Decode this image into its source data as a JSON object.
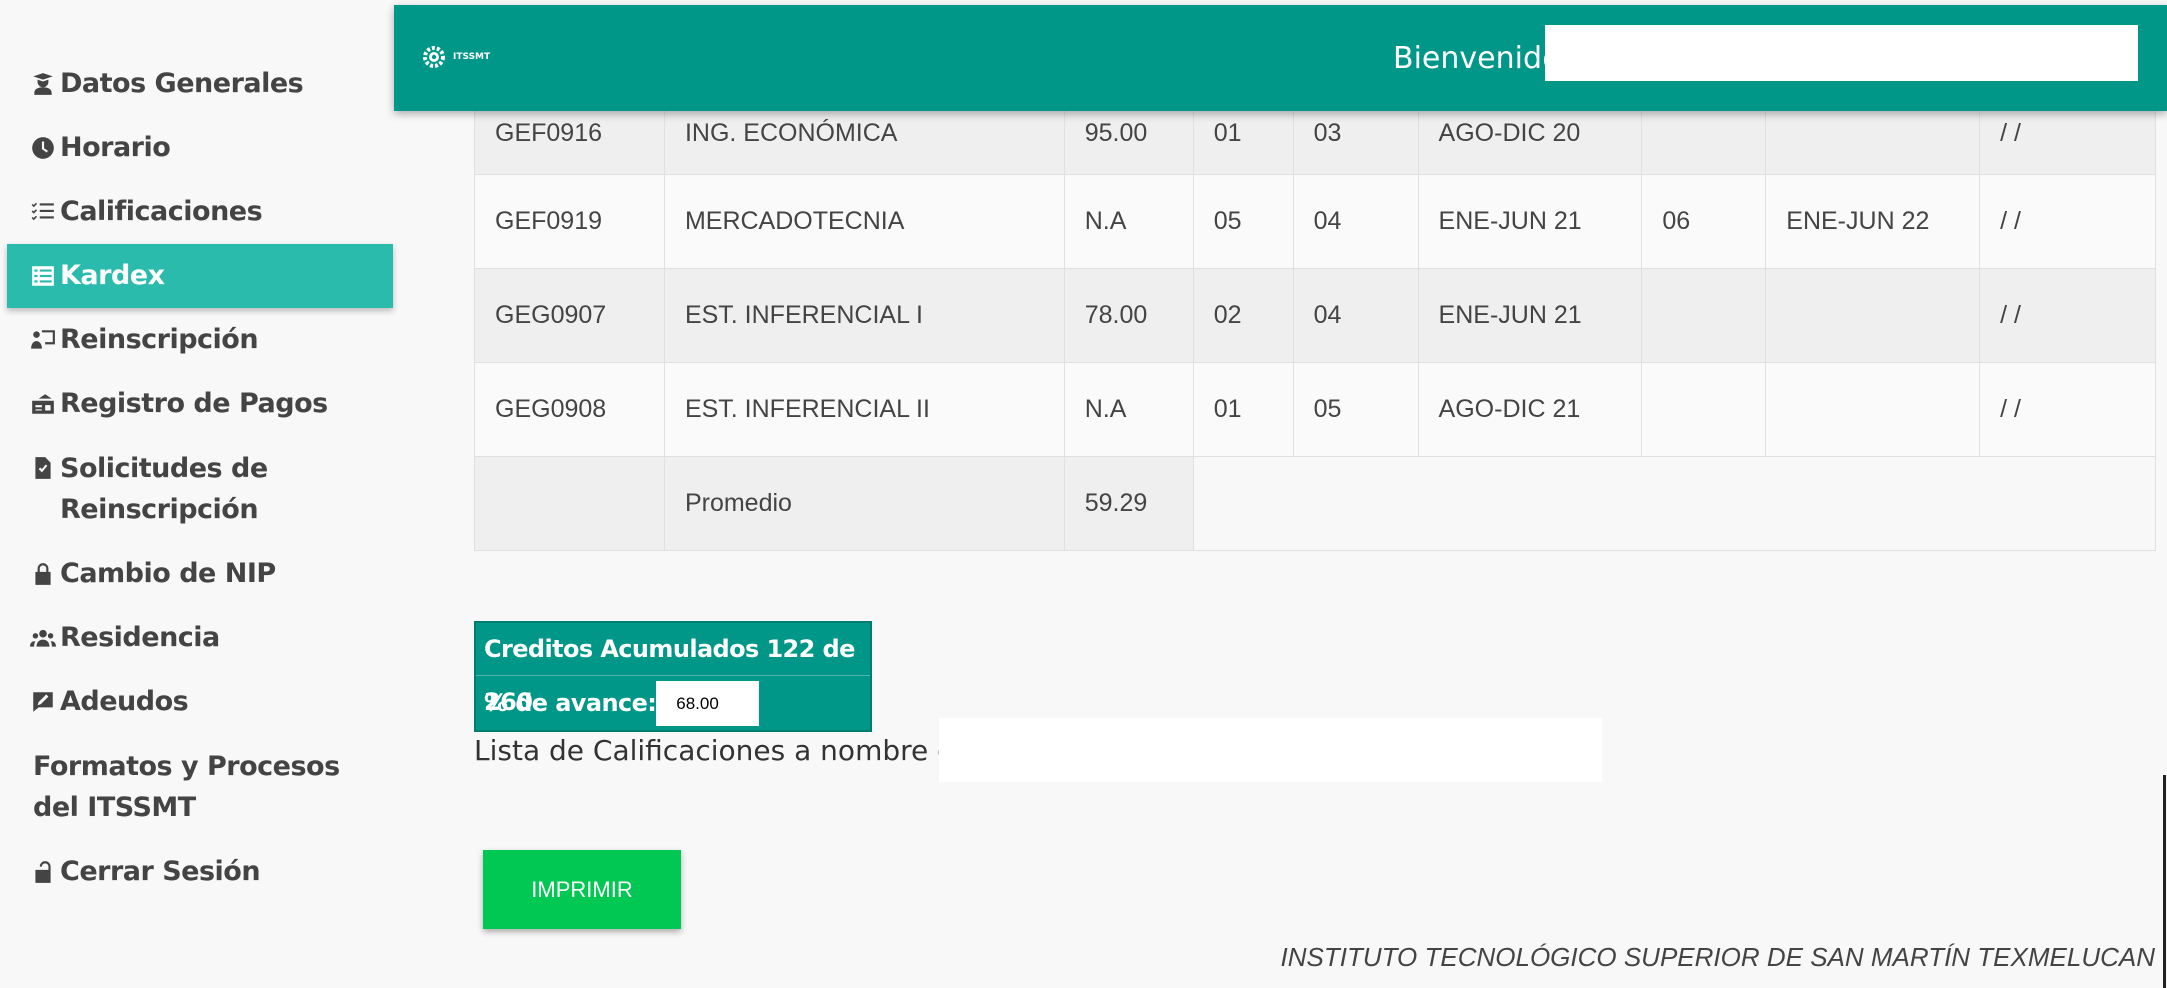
{
  "sidebar": {
    "items": [
      {
        "label": "Datos Generales",
        "icon": "user-graduate-icon"
      },
      {
        "label": "Horario",
        "icon": "clock-icon"
      },
      {
        "label": "Calificaciones",
        "icon": "list-check-icon"
      },
      {
        "label": "Kardex",
        "icon": "list-alt-icon",
        "active": true
      },
      {
        "label": "Reinscripción",
        "icon": "chalkboard-teacher-icon"
      },
      {
        "label": "Registro de Pagos",
        "icon": "money-check-icon"
      },
      {
        "label": "Solicitudes de Reinscripción",
        "icon": "file-check-icon"
      },
      {
        "label": "Cambio de NIP",
        "icon": "lock-icon"
      },
      {
        "label": "Residencia",
        "icon": "users-icon"
      },
      {
        "label": "Adeudos",
        "icon": "comment-edit-icon"
      },
      {
        "label": "Formatos y Procesos del ITSSMT",
        "icon": ""
      },
      {
        "label": "Cerrar Sesión",
        "icon": "lock-open-icon"
      }
    ]
  },
  "header": {
    "logo_text": "ITSSMT",
    "welcome": "Bienvenid@",
    "welcome_value": ""
  },
  "kardex": {
    "rows": [
      [
        "GEF0916",
        "ING. ECONÓMICA",
        "95.00",
        "01",
        "03",
        "AGO-DIC 20",
        "",
        "",
        "/ /"
      ],
      [
        "GEF0919",
        "MERCADOTECNIA",
        "N.A",
        "05",
        "04",
        "ENE-JUN 21",
        "06",
        "ENE-JUN 22",
        "/ /"
      ],
      [
        "GEG0907",
        "EST. INFERENCIAL I",
        "78.00",
        "02",
        "04",
        "ENE-JUN 21",
        "",
        "",
        "/ /"
      ],
      [
        "GEG0908",
        "EST. INFERENCIAL II",
        "N.A",
        "01",
        "05",
        "AGO-DIC 21",
        "",
        "",
        "/ /"
      ]
    ],
    "average_label": "Promedio",
    "average_value": "59.29"
  },
  "credits": {
    "accumulated_label": "Creditos Acumulados 122 de 260",
    "progress_label": "% de avance:",
    "progress_value": "68.00"
  },
  "name_list": {
    "label": "Lista de Calificaciones a nombre de:",
    "value": ""
  },
  "print_button": "IMPRIMIR",
  "footer": "INSTITUTO TECNOLÓGICO SUPERIOR DE SAN MARTÍN TEXMELUCAN",
  "colors": {
    "primary": "#009688",
    "sidebar_active": "#2bbbad",
    "print_button": "#00c853"
  }
}
